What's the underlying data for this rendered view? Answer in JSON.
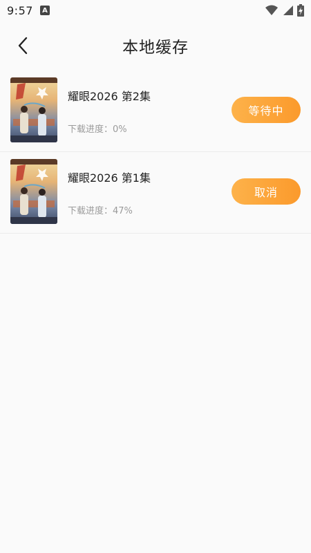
{
  "status_bar": {
    "time": "9:57",
    "notification_letter": "A",
    "icons": [
      "wifi-icon",
      "signal-icon",
      "battery-charging-icon"
    ]
  },
  "header": {
    "back_icon": "chevron-left-icon",
    "title": "本地缓存"
  },
  "downloads": [
    {
      "title": "耀眼2026   第2集",
      "progress_text": "下载进度：0%",
      "progress": 0,
      "action_label": "等待中",
      "thumbnail": "drama-poster"
    },
    {
      "title": "耀眼2026   第1集",
      "progress_text": "下载进度：47%",
      "progress": 47,
      "action_label": "取消",
      "thumbnail": "drama-poster"
    }
  ],
  "colors": {
    "accent_start": "#fdb24a",
    "accent_end": "#fb9a2c",
    "background": "#fafafa"
  }
}
